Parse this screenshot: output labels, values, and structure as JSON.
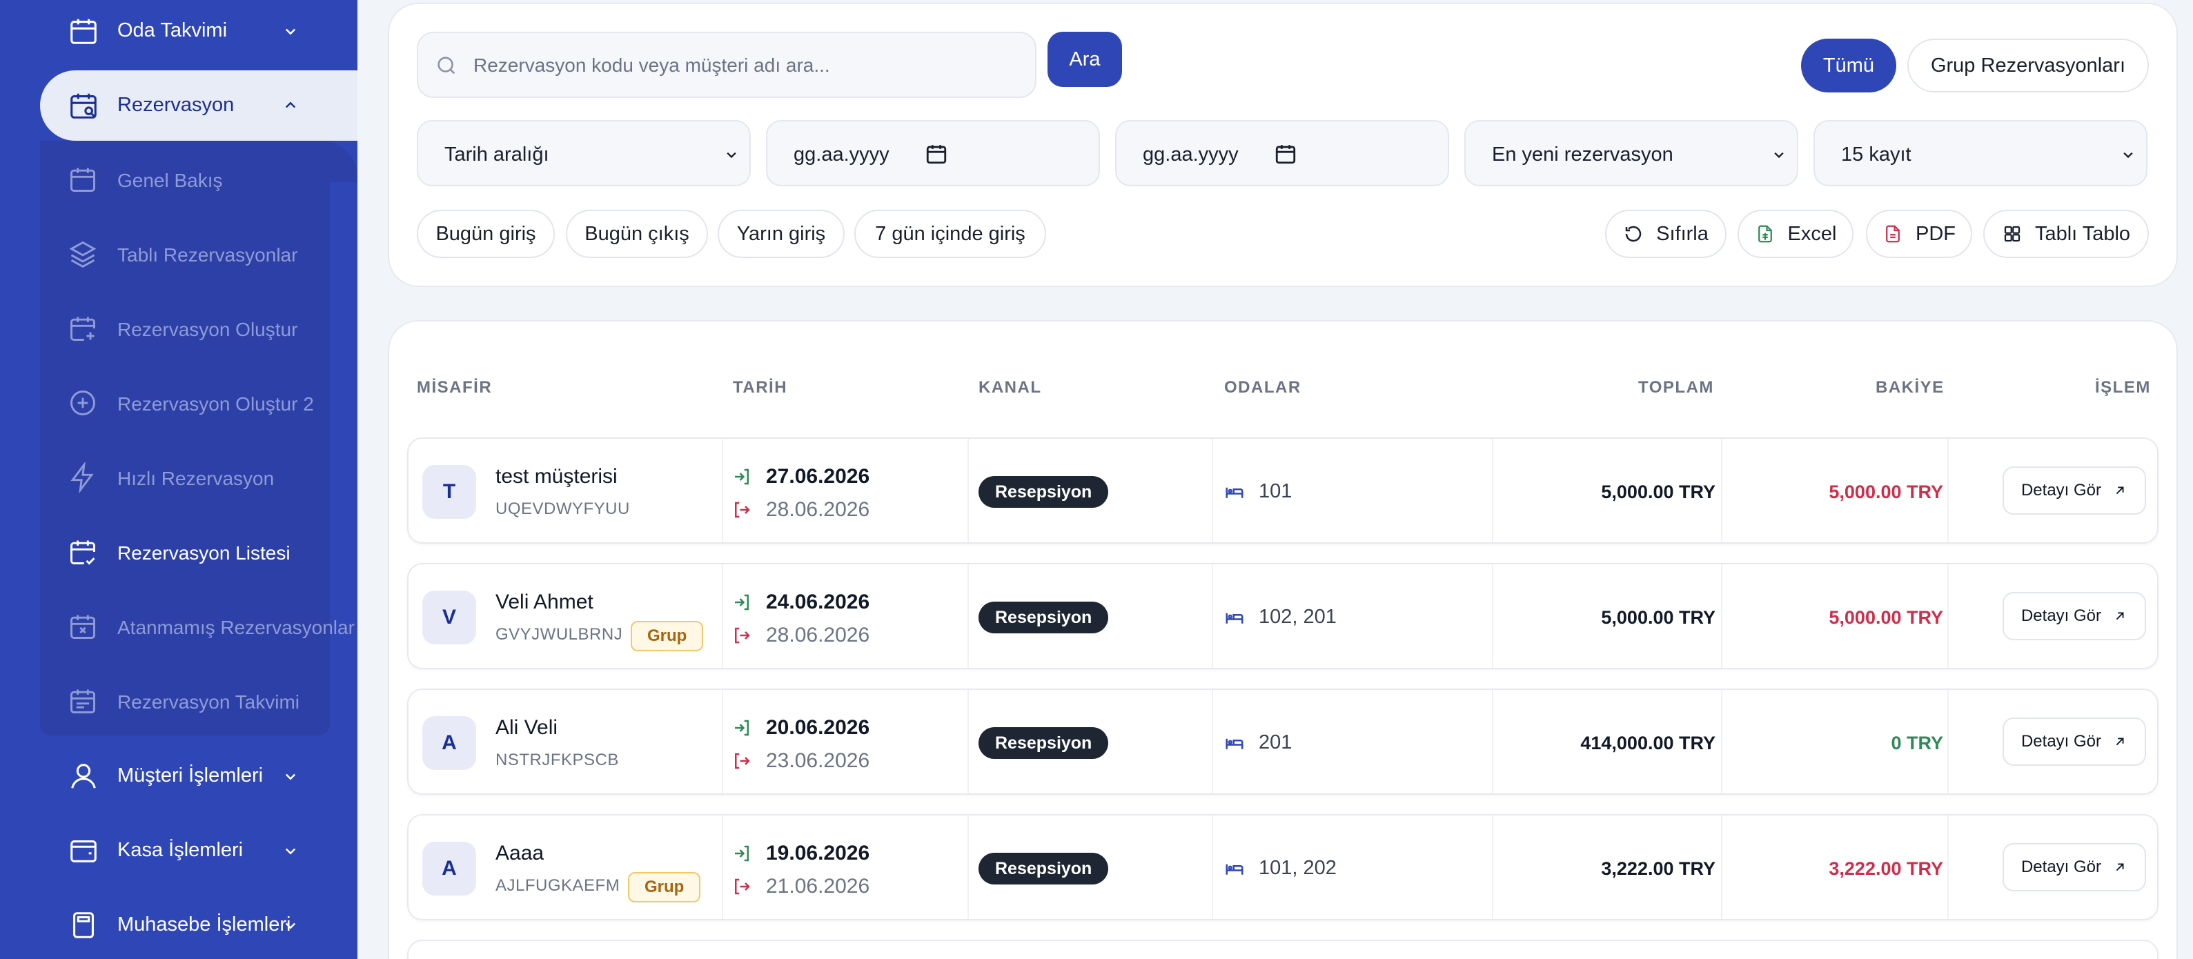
{
  "sidebar": {
    "items": [
      {
        "label": "Oda Takvimi",
        "icon": "calendar-icon"
      },
      {
        "label": "Rezervasyon",
        "icon": "calendar-search-icon"
      },
      {
        "label": "Müşteri İşlemleri",
        "icon": "user-icon"
      },
      {
        "label": "Kasa İşlemleri",
        "icon": "wallet-icon"
      },
      {
        "label": "Muhasebe İşlemleri",
        "icon": "calculator-icon"
      }
    ],
    "sub_items": [
      {
        "label": "Genel Bakış",
        "icon": "calendar-icon"
      },
      {
        "label": "Tablı Rezervasyonlar",
        "icon": "layers-icon"
      },
      {
        "label": "Rezervasyon Oluştur",
        "icon": "calendar-plus-icon"
      },
      {
        "label": "Rezervasyon Oluştur 2",
        "icon": "plus-circle-icon"
      },
      {
        "label": "Hızlı Rezervasyon",
        "icon": "bolt-icon"
      },
      {
        "label": "Rezervasyon Listesi",
        "icon": "calendar-check-icon"
      },
      {
        "label": "Atanmamış Rezervasyonlar",
        "icon": "calendar-x-icon"
      },
      {
        "label": "Rezervasyon Takvimi",
        "icon": "calendar-list-icon"
      }
    ]
  },
  "filters": {
    "search_placeholder": "Rezervasyon kodu veya müşteri adı ara...",
    "search_button": "Ara",
    "toggle_all": "Tümü",
    "toggle_group": "Grup Rezervasyonları",
    "date_range": "Tarih aralığı",
    "date_start": "gg.aa.yyyy",
    "date_end": "gg.aa.yyyy",
    "sort": "En yeni rezervasyon",
    "page_size": "15 kayıt",
    "quick": [
      "Bugün giriş",
      "Bugün çıkış",
      "Yarın giriş",
      "7 gün içinde giriş"
    ],
    "reset": "Sıfırla",
    "excel": "Excel",
    "pdf": "PDF",
    "tab_table": "Tablı Tablo"
  },
  "table": {
    "headers": [
      "MİSAFİR",
      "TARİH",
      "KANAL",
      "ODALAR",
      "TOPLAM",
      "BAKİYE",
      "İŞLEM"
    ],
    "detail_label": "Detayı Gör",
    "group_label": "Grup",
    "rows": [
      {
        "initial": "T",
        "name": "test müşterisi",
        "code": "UQEVDWYFYUU",
        "group": false,
        "check_in": "27.06.2026",
        "check_out": "28.06.2026",
        "channel": "Resepsiyon",
        "rooms": "101",
        "total": "5,000.00 TRY",
        "balance": "5,000.00 TRY",
        "balance_color": "#d12d4a"
      },
      {
        "initial": "V",
        "name": "Veli Ahmet",
        "code": "GVYJWULBRNJ",
        "group": true,
        "check_in": "24.06.2026",
        "check_out": "28.06.2026",
        "channel": "Resepsiyon",
        "rooms": "102, 201",
        "total": "5,000.00 TRY",
        "balance": "5,000.00 TRY",
        "balance_color": "#d12d4a"
      },
      {
        "initial": "A",
        "name": "Ali Veli",
        "code": "NSTRJFKPSCB",
        "group": false,
        "check_in": "20.06.2026",
        "check_out": "23.06.2026",
        "channel": "Resepsiyon",
        "rooms": "201",
        "total": "414,000.00 TRY",
        "balance": "0 TRY",
        "balance_color": "#2e8a57"
      },
      {
        "initial": "A",
        "name": "Aaaa",
        "code": "AJLFUGKAEFM",
        "group": true,
        "check_in": "19.06.2026",
        "check_out": "21.06.2026",
        "channel": "Resepsiyon",
        "rooms": "101, 202",
        "total": "3,222.00 TRY",
        "balance": "3,222.00 TRY",
        "balance_color": "#d12d4a"
      }
    ]
  }
}
